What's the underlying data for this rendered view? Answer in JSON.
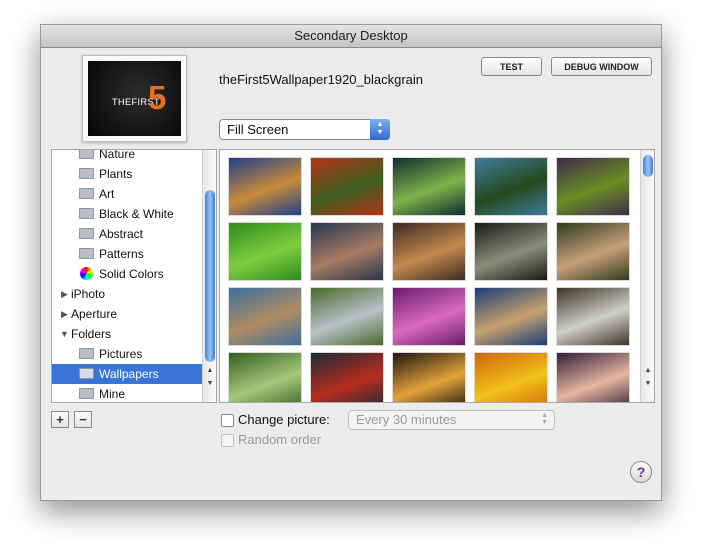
{
  "window": {
    "title": "Secondary Desktop"
  },
  "preview": {
    "logo_text": "THEFIRST",
    "logo_number": "5"
  },
  "current_wallpaper": "theFirst5Wallpaper1920_blackgrain",
  "buttons": {
    "test": "TEST",
    "debug_window": "DEBUG WINDOW"
  },
  "fit_popup": {
    "selected": "Fill Screen"
  },
  "sidebar": {
    "items": [
      {
        "label": "Nature"
      },
      {
        "label": "Plants"
      },
      {
        "label": "Art"
      },
      {
        "label": "Black & White"
      },
      {
        "label": "Abstract"
      },
      {
        "label": "Patterns"
      },
      {
        "label": "Solid Colors"
      },
      {
        "label": "iPhoto"
      },
      {
        "label": "Aperture"
      },
      {
        "label": "Folders"
      },
      {
        "label": "Pictures"
      },
      {
        "label": "Wallpapers"
      },
      {
        "label": "Mine"
      }
    ],
    "add_label": "+",
    "remove_label": "−"
  },
  "options": {
    "change_picture_label": "Change picture:",
    "interval_selected": "Every 30 minutes",
    "random_order_label": "Random order"
  },
  "help_label": "?",
  "thumbnail_colors": [
    [
      "#1d3f8a",
      "#c98b3a"
    ],
    [
      "#b53417",
      "#3c5e1e"
    ],
    [
      "#0e2f2e",
      "#7fb34a"
    ],
    [
      "#3f7b9c",
      "#244a1c"
    ],
    [
      "#3f2a4e",
      "#6a8f22"
    ],
    [
      "#2f8a1f",
      "#7dcf3d"
    ],
    [
      "#27364f",
      "#a77c63"
    ],
    [
      "#3b2b22",
      "#c4894e"
    ],
    [
      "#1a1a14",
      "#8a8e7a"
    ],
    [
      "#2f3c1c",
      "#c7a07c"
    ],
    [
      "#3d6f9f",
      "#b08c62"
    ],
    [
      "#4a6a2a",
      "#b9c2c8"
    ],
    [
      "#6a1d6a",
      "#d96ac0"
    ],
    [
      "#1a3d7a",
      "#c7a26d"
    ],
    [
      "#3e3526",
      "#cfcfc8"
    ],
    [
      "#355f21",
      "#a3c97a"
    ],
    [
      "#1e2a36",
      "#b62d1e"
    ],
    [
      "#1c1610",
      "#e4a23a"
    ],
    [
      "#d0660c",
      "#f2c21a"
    ],
    [
      "#2e1f3a",
      "#e7b6a0"
    ]
  ]
}
